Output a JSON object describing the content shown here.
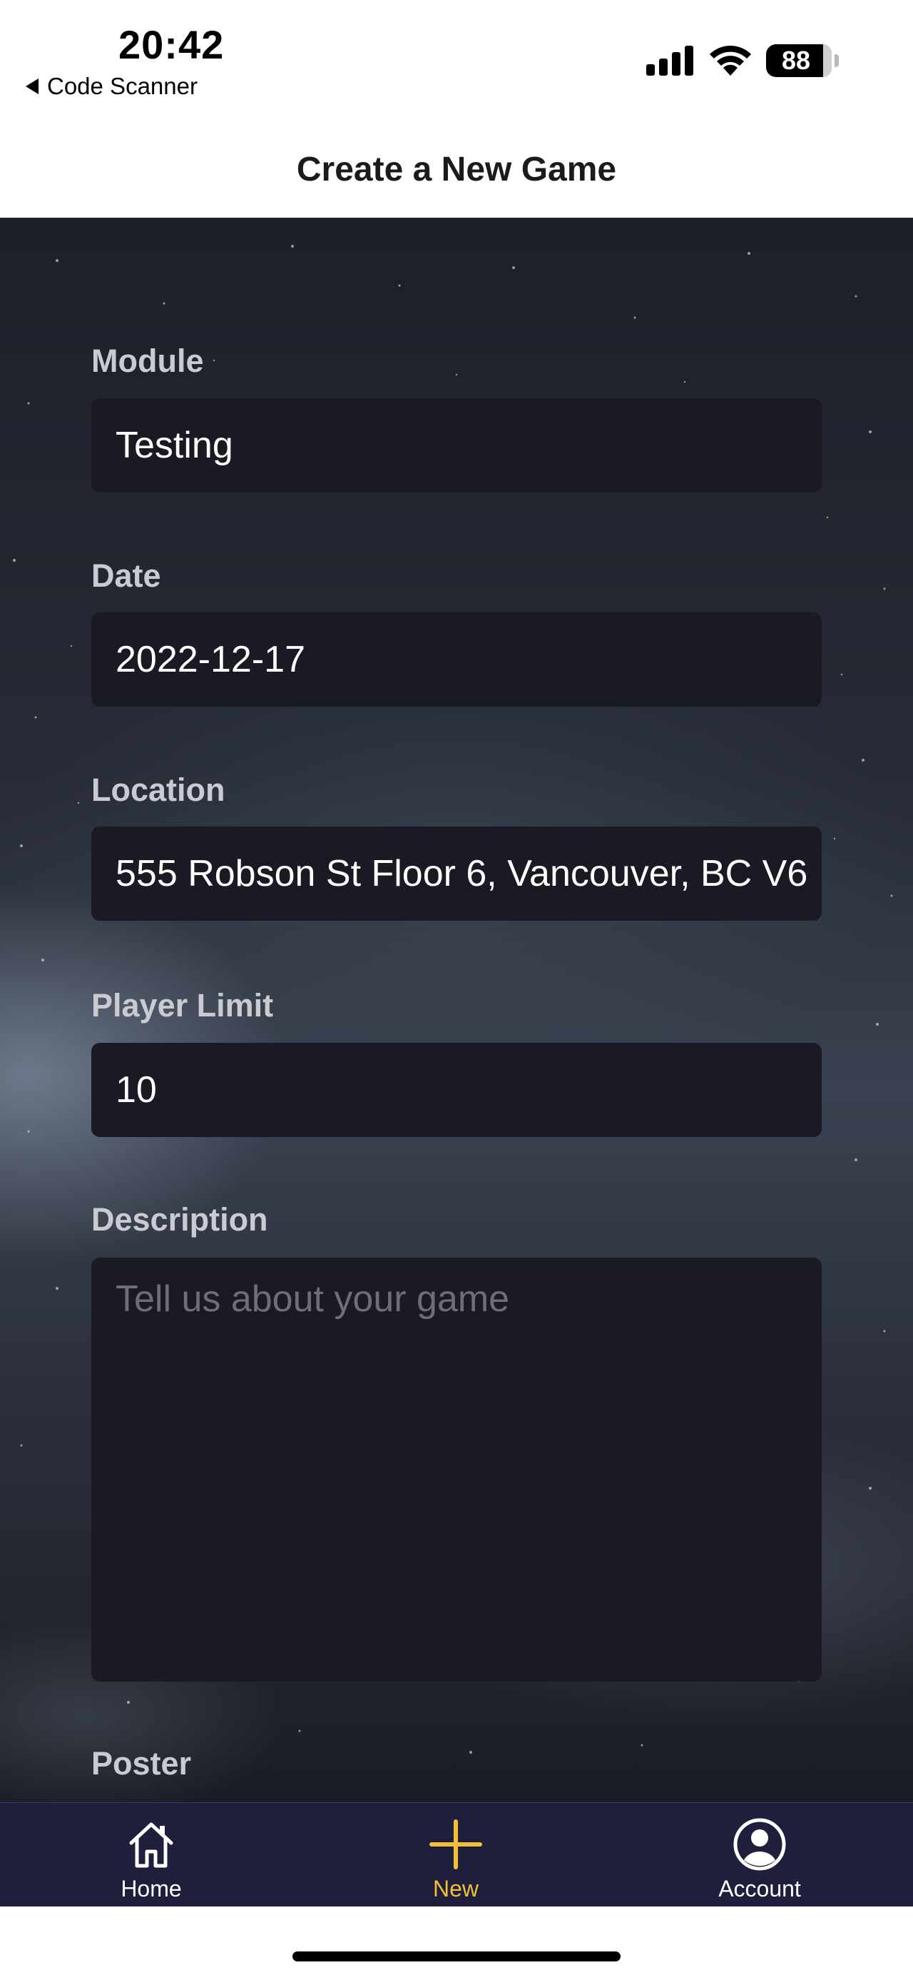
{
  "status_bar": {
    "time": "20:42",
    "back_app": "Code Scanner",
    "battery": "88"
  },
  "header": {
    "title": "Create a New Game"
  },
  "form": {
    "module": {
      "label": "Module",
      "value": "Testing"
    },
    "date": {
      "label": "Date",
      "value": "2022-12-17"
    },
    "location": {
      "label": "Location",
      "value": "555 Robson St Floor 6, Vancouver, BC V6"
    },
    "player_limit": {
      "label": "Player Limit",
      "value": "10"
    },
    "description": {
      "label": "Description",
      "placeholder": "Tell us about your game",
      "value": ""
    },
    "poster": {
      "label": "Poster"
    }
  },
  "tabs": [
    {
      "label": "Home",
      "icon": "home-icon",
      "active": false
    },
    {
      "label": "New",
      "icon": "plus-icon",
      "active": true
    },
    {
      "label": "Account",
      "icon": "account-icon",
      "active": false
    }
  ],
  "colors": {
    "field_bg": "#191a24",
    "tab_bar_bg": "#1f1e3d",
    "accent": "#f2c037",
    "label": "#c9cbd0"
  }
}
